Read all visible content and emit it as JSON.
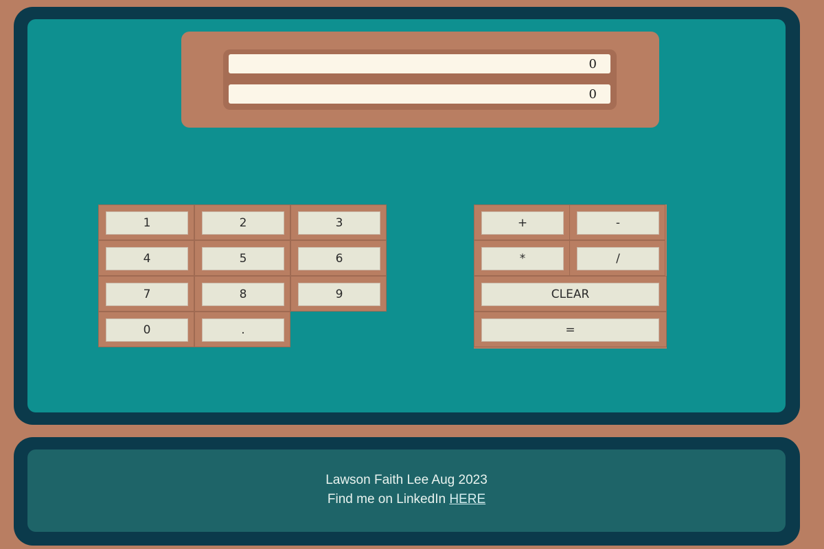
{
  "display": {
    "line1": "0",
    "line2": "0"
  },
  "number_keys": [
    [
      "1",
      "2",
      "3"
    ],
    [
      "4",
      "5",
      "6"
    ],
    [
      "7",
      "8",
      "9"
    ],
    [
      "0",
      "."
    ]
  ],
  "operator_keys": {
    "plus": "+",
    "minus": "-",
    "multiply": "*",
    "divide": "/",
    "clear": "CLEAR",
    "equals": "="
  },
  "footer": {
    "credit": "Lawson Faith Lee Aug 2023",
    "linkedin_prefix": "Find me on LinkedIn",
    "linkedin_link": "HERE"
  },
  "colors": {
    "page_background": "#b97e62",
    "frame": "#0b3a4b",
    "calculator_body": "#0e9090",
    "footer_body": "#1e6468",
    "key_face": "#e6e6d6",
    "display_face": "#fcf6e8"
  }
}
